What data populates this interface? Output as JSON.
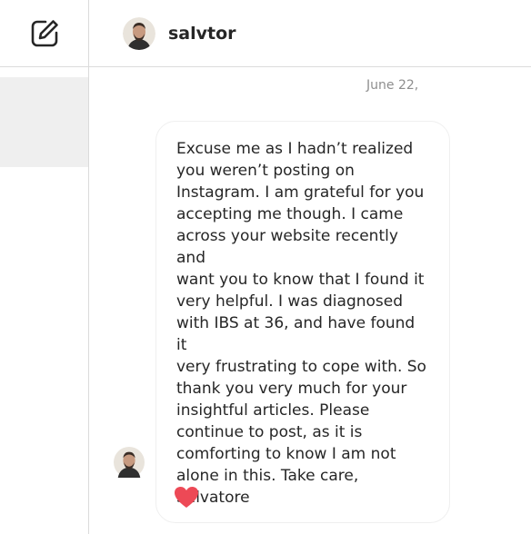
{
  "header": {
    "username": "salvtor"
  },
  "thread": {
    "date": "June 22,",
    "message": "Excuse me as I hadn’t realized\nyou weren’t posting on\nInstagram. I am grateful for you\naccepting me though. I came\nacross your website recently and\nwant you to know that I found it\nvery helpful. I was diagnosed\nwith IBS at 36, and have found it\nvery frustrating to cope with. So\nthank you very much for your\ninsightful articles. Please\ncontinue to post, as it is\ncomforting to know I am not\nalone in this. Take care,\nSalvatore",
    "reaction_icon": "heart-icon"
  },
  "colors": {
    "reaction": "#ed4956",
    "divider": "#dbdbdb",
    "selected_row": "#efefef",
    "timestamp": "#8e8e8e"
  }
}
